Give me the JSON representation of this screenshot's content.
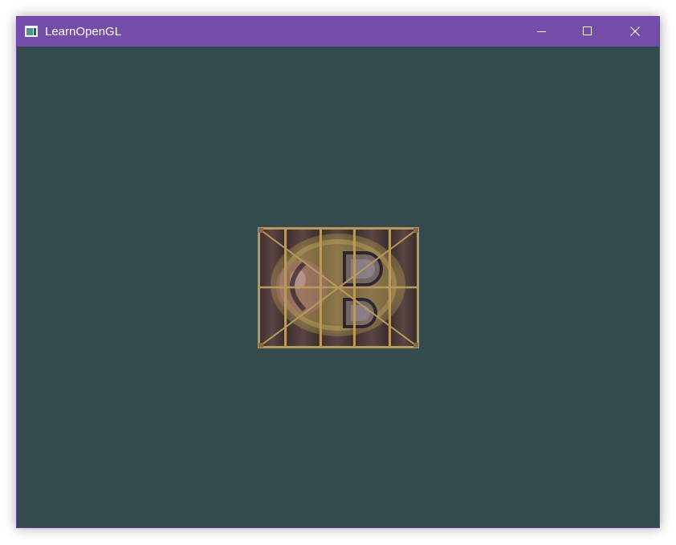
{
  "window": {
    "title": "LearnOpenGL",
    "app_icon": "window-app-icon",
    "titlebar_color": "#744da9",
    "clear_color": "#334b4c"
  },
  "caption_buttons": {
    "minimize_icon": "minimize-icon",
    "maximize_icon": "maximize-icon",
    "close_icon": "close-icon"
  },
  "scene": {
    "object": "textured-quad",
    "texture_1": "wooden-container",
    "texture_2": "awesomeface",
    "colors": {
      "wood_dark": "#4a3a38",
      "wood_light": "#7a5f56",
      "frame": "#b8995e",
      "face_yellow": "#c9b055",
      "face_pink": "#b9807d"
    }
  }
}
